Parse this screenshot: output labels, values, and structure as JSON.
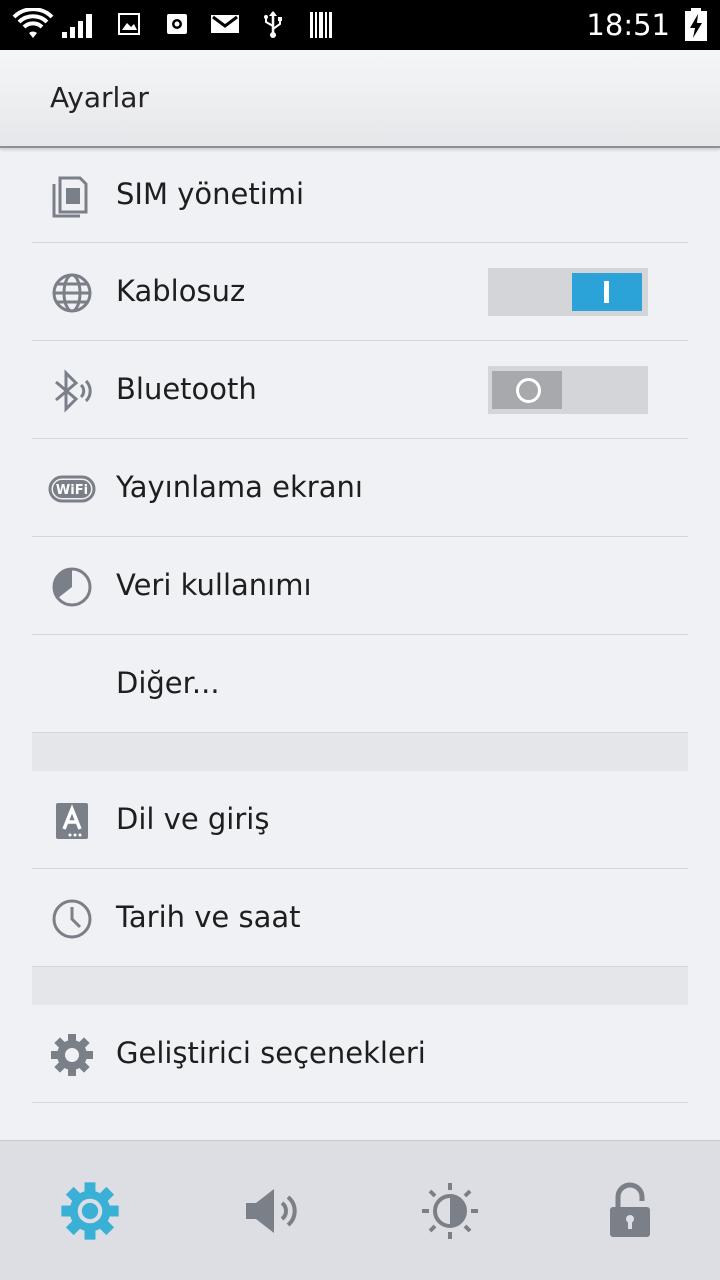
{
  "status_bar": {
    "time": "18:51",
    "icons": [
      "wifi-icon",
      "signal-icon",
      "image-icon",
      "camera-icon",
      "gmail-icon",
      "usb-icon",
      "barcode-icon",
      "battery-charging-icon"
    ]
  },
  "action_bar": {
    "title": "Ayarlar"
  },
  "settings": [
    {
      "label": "SIM yönetimi",
      "icon": "sim-card-icon"
    },
    {
      "label": "Kablosuz",
      "icon": "globe-icon",
      "toggle": "on"
    },
    {
      "label": "Bluetooth",
      "icon": "bluetooth-icon",
      "toggle": "off"
    },
    {
      "label": "Yayınlama ekranı",
      "icon": "wifi-display-icon"
    },
    {
      "label": "Veri kullanımı",
      "icon": "data-usage-icon"
    },
    {
      "label": "Diğer..."
    },
    {
      "label": "Dil ve giriş",
      "icon": "language-icon"
    },
    {
      "label": "Tarih ve saat",
      "icon": "clock-icon"
    },
    {
      "label": "Geliştirici seçenekleri",
      "icon": "gear-icon"
    }
  ],
  "bottom_tabs": [
    {
      "name": "settings",
      "icon": "gear-icon",
      "active": true
    },
    {
      "name": "sound",
      "icon": "speaker-icon",
      "active": false
    },
    {
      "name": "display",
      "icon": "brightness-icon",
      "active": false
    },
    {
      "name": "security",
      "icon": "lock-icon",
      "active": false
    }
  ],
  "colors": {
    "accent": "#2ba3d8",
    "icon_gray": "#7a7f88",
    "active_tab": "#3ab0d6"
  }
}
